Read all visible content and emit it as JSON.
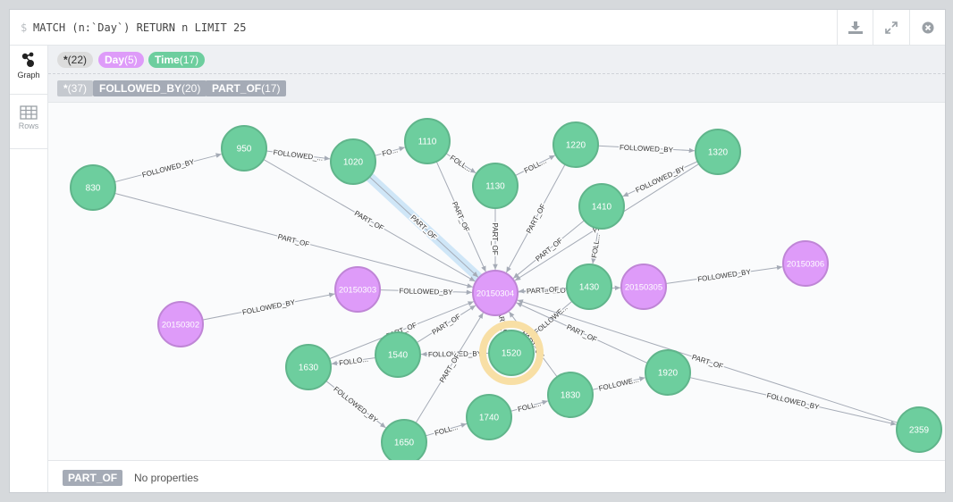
{
  "query": {
    "prompt": "$",
    "text": "MATCH (n:`Day`) RETURN n LIMIT 25"
  },
  "toolbar": {
    "download_icon": "download-icon",
    "expand_icon": "expand-icon",
    "close_icon": "close-icon"
  },
  "sidebar": {
    "graph_label": "Graph",
    "rows_label": "Rows"
  },
  "node_labels": [
    {
      "name": "*",
      "count": "(22)",
      "color": "#dcdcdc",
      "text_color": "#333"
    },
    {
      "name": "Day",
      "count": "(5)",
      "color": "#de9bf9",
      "text_color": "#fff"
    },
    {
      "name": "Time",
      "count": "(17)",
      "color": "#6dce9e",
      "text_color": "#fff"
    }
  ],
  "rel_types": [
    {
      "name": "*",
      "count": "(37)"
    },
    {
      "name": "FOLLOWED_BY",
      "count": "(20)"
    },
    {
      "name": "PART_OF",
      "count": "(17)"
    }
  ],
  "colors": {
    "time_fill": "#6dce9e",
    "time_stroke": "#60b58b",
    "day_fill": "#de9bf9",
    "day_stroke": "#bf85d6",
    "edge": "#a5abb6",
    "selected_edge": "#cfe6f7",
    "selected_node": "#f8dfa5"
  },
  "graph": {
    "nodes": [
      {
        "id": "n830",
        "label": "830",
        "type": "Time"
      },
      {
        "id": "n950",
        "label": "950",
        "type": "Time"
      },
      {
        "id": "n1020",
        "label": "1020",
        "type": "Time"
      },
      {
        "id": "n1110",
        "label": "1110",
        "type": "Time"
      },
      {
        "id": "n1130",
        "label": "1130",
        "type": "Time"
      },
      {
        "id": "n1220",
        "label": "1220",
        "type": "Time"
      },
      {
        "id": "n1320",
        "label": "1320",
        "type": "Time"
      },
      {
        "id": "n1410",
        "label": "1410",
        "type": "Time"
      },
      {
        "id": "n1430",
        "label": "1430",
        "type": "Time"
      },
      {
        "id": "n1520",
        "label": "1520",
        "type": "Time",
        "selected": true
      },
      {
        "id": "n1540",
        "label": "1540",
        "type": "Time"
      },
      {
        "id": "n1630",
        "label": "1630",
        "type": "Time"
      },
      {
        "id": "n1650",
        "label": "1650",
        "type": "Time"
      },
      {
        "id": "n1740",
        "label": "1740",
        "type": "Time"
      },
      {
        "id": "n1830",
        "label": "1830",
        "type": "Time"
      },
      {
        "id": "n1920",
        "label": "1920",
        "type": "Time"
      },
      {
        "id": "n2359",
        "label": "2359",
        "type": "Time"
      },
      {
        "id": "d20150302",
        "label": "20150302",
        "type": "Day"
      },
      {
        "id": "d20150303",
        "label": "20150303",
        "type": "Day"
      },
      {
        "id": "d20150304",
        "label": "20150304",
        "type": "Day"
      },
      {
        "id": "d20150305",
        "label": "20150305",
        "type": "Day"
      },
      {
        "id": "d20150306",
        "label": "20150306",
        "type": "Day"
      }
    ],
    "edges": [
      {
        "from": "n830",
        "to": "n950",
        "label": "FOLLOWED_BY"
      },
      {
        "from": "n950",
        "to": "n1020",
        "label": "FOLLOWED_..."
      },
      {
        "from": "n1020",
        "to": "n1110",
        "label": "FO..."
      },
      {
        "from": "n1110",
        "to": "n1130",
        "label": "FOLL..."
      },
      {
        "from": "n1130",
        "to": "n1220",
        "label": "FOLL..."
      },
      {
        "from": "n1220",
        "to": "n1320",
        "label": "FOLLOWED_BY"
      },
      {
        "from": "n1320",
        "to": "n1410",
        "label": "FOLLOWED_BY"
      },
      {
        "from": "n1410",
        "to": "n1430",
        "label": "FOLL..."
      },
      {
        "from": "n1430",
        "to": "n1520",
        "label": "FOLLOWE..."
      },
      {
        "from": "n1520",
        "to": "n1540",
        "label": "FOLLOWED_BY"
      },
      {
        "from": "n1540",
        "to": "n1630",
        "label": "FOLLO..."
      },
      {
        "from": "n1630",
        "to": "n1650",
        "label": "FOLLOWED_BY"
      },
      {
        "from": "n1650",
        "to": "n1740",
        "label": "FOLL..."
      },
      {
        "from": "n1740",
        "to": "n1830",
        "label": "FOLL..."
      },
      {
        "from": "n1830",
        "to": "n1920",
        "label": "FOLLOWE..."
      },
      {
        "from": "n1920",
        "to": "n2359",
        "label": "FOLLOWED_BY"
      },
      {
        "from": "d20150302",
        "to": "d20150303",
        "label": "FOLLOWED_BY"
      },
      {
        "from": "d20150303",
        "to": "d20150304",
        "label": "FOLLOWED_BY"
      },
      {
        "from": "d20150304",
        "to": "d20150305",
        "label": "FOLLOWED_BY"
      },
      {
        "from": "d20150305",
        "to": "d20150306",
        "label": "FOLLOWED_BY"
      },
      {
        "from": "n830",
        "to": "d20150304",
        "label": "PART_OF"
      },
      {
        "from": "n950",
        "to": "d20150304",
        "label": "PART_OF"
      },
      {
        "from": "n1020",
        "to": "d20150304",
        "label": "PART_OF",
        "selected": true
      },
      {
        "from": "n1110",
        "to": "d20150304",
        "label": "PART_OF"
      },
      {
        "from": "n1130",
        "to": "d20150304",
        "label": "PART_OF"
      },
      {
        "from": "n1220",
        "to": "d20150304",
        "label": "PART_OF"
      },
      {
        "from": "n1320",
        "to": "d20150304",
        "label": "PART_OF"
      },
      {
        "from": "n1410",
        "to": "d20150304",
        "label": "PART_OF"
      },
      {
        "from": "n1430",
        "to": "d20150304",
        "label": "PART_OF"
      },
      {
        "from": "n1520",
        "to": "d20150304",
        "label": "PART_OF"
      },
      {
        "from": "n1540",
        "to": "d20150304",
        "label": "PART_OF"
      },
      {
        "from": "n1630",
        "to": "d20150304",
        "label": "PART_OF"
      },
      {
        "from": "n1650",
        "to": "d20150304",
        "label": "PART_OF"
      },
      {
        "from": "n1830",
        "to": "d20150304",
        "label": "PART_OF"
      },
      {
        "from": "n1920",
        "to": "d20150304",
        "label": "PART_OF"
      },
      {
        "from": "n2359",
        "to": "d20150304",
        "label": "PART_OF"
      }
    ]
  },
  "inspector": {
    "type": "PART_OF",
    "text": "No properties"
  }
}
